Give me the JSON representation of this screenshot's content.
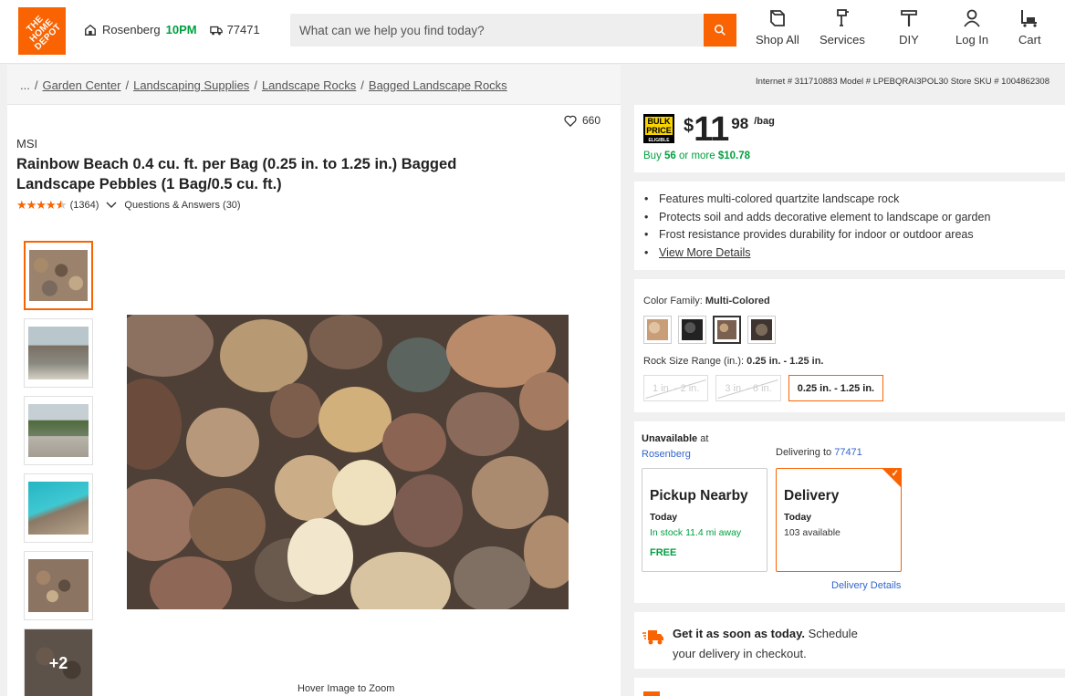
{
  "header": {
    "logo_text": "THE HOME DEPOT",
    "store_name": "Rosenberg",
    "store_hours": "10PM",
    "zip": "77471",
    "search_placeholder": "What can we help you find today?",
    "nav": [
      {
        "label": "Shop All",
        "icon": "shop-all-icon"
      },
      {
        "label": "Services",
        "icon": "services-icon"
      },
      {
        "label": "DIY",
        "icon": "diy-icon"
      },
      {
        "label": "Log In",
        "icon": "user-icon"
      },
      {
        "label": "Cart",
        "icon": "cart-icon"
      }
    ]
  },
  "breadcrumb": {
    "ellipsis": "...",
    "items": [
      "Garden Center",
      "Landscaping Supplies",
      "Landscape Rocks",
      "Bagged Landscape Rocks"
    ]
  },
  "product_ids": "Internet # 311710883  Model # LPEBQRAI3POL30  Store SKU # 1004862308",
  "product": {
    "brand": "MSI",
    "title": "Rainbow Beach 0.4 cu. ft. per Bag (0.25 in. to 1.25 in.) Bagged Landscape Pebbles (1 Bag/0.5 cu. ft.)",
    "favorites": "660",
    "rating_stars": 4.5,
    "review_count": "(1364)",
    "qa_link": "Questions & Answers (30)",
    "more_images": "+2",
    "hover_hint": "Hover Image to Zoom"
  },
  "price": {
    "currency": "$",
    "dollars": "11",
    "cents": "98",
    "unit": "/bag",
    "bulk_badge_top": "BULK",
    "bulk_badge_mid": "PRICE",
    "bulk_badge_bottom": "ELIGIBLE",
    "bulk_text": "Buy",
    "bulk_qty": "56",
    "bulk_mid": "or more",
    "bulk_price": "$10.78"
  },
  "features": [
    "Features multi-colored quartzite landscape rock",
    "Protects soil and adds decorative element to landscape or garden",
    "Frost resistance provides durability for indoor or outdoor areas"
  ],
  "view_more": "View More Details",
  "options": {
    "color_label": "Color Family:",
    "color_value": "Multi-Colored",
    "size_label": "Rock Size Range (in.):",
    "size_value": "0.25 in. - 1.25 in.",
    "sizes": [
      "1 in. - 2 in.",
      "3 in. - 6 in.",
      "0.25 in. - 1.25 in."
    ]
  },
  "fulfillment": {
    "unavailable_label": "Unavailable",
    "unavailable_at": "at",
    "store": "Rosenberg",
    "delivering_label": "Delivering to",
    "delivering_zip": "77471",
    "pickup": {
      "heading": "Pickup Nearby",
      "when": "Today",
      "stock": "In stock 11.4 mi away",
      "price": "FREE"
    },
    "delivery": {
      "heading": "Delivery",
      "when": "Today",
      "stock": "103 available"
    },
    "details_link": "Delivery Details"
  },
  "promo": {
    "bold": "Get it as soon as today.",
    "text": "Schedule",
    "text2": "your delivery in checkout."
  },
  "colors": {
    "brand": "#f96302",
    "green": "#00a040",
    "link": "#3366cc"
  }
}
